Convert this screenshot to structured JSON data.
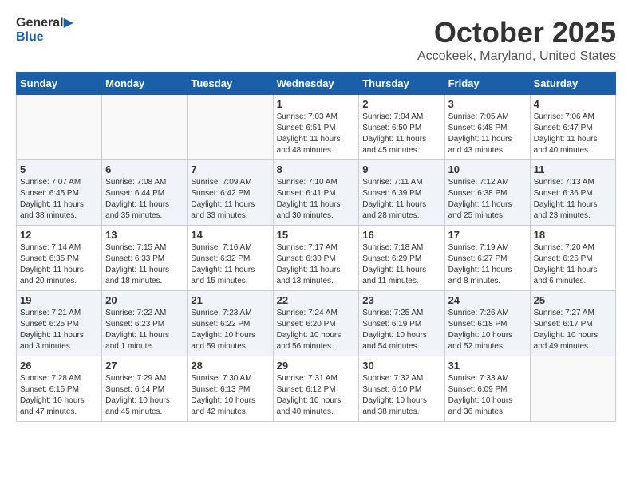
{
  "header": {
    "logo_general": "General",
    "logo_blue": "Blue",
    "month_title": "October 2025",
    "location": "Accokeek, Maryland, United States"
  },
  "weekdays": [
    "Sunday",
    "Monday",
    "Tuesday",
    "Wednesday",
    "Thursday",
    "Friday",
    "Saturday"
  ],
  "weeks": [
    [
      {
        "num": "",
        "info": ""
      },
      {
        "num": "",
        "info": ""
      },
      {
        "num": "",
        "info": ""
      },
      {
        "num": "1",
        "info": "Sunrise: 7:03 AM\nSunset: 6:51 PM\nDaylight: 11 hours\nand 48 minutes."
      },
      {
        "num": "2",
        "info": "Sunrise: 7:04 AM\nSunset: 6:50 PM\nDaylight: 11 hours\nand 45 minutes."
      },
      {
        "num": "3",
        "info": "Sunrise: 7:05 AM\nSunset: 6:48 PM\nDaylight: 11 hours\nand 43 minutes."
      },
      {
        "num": "4",
        "info": "Sunrise: 7:06 AM\nSunset: 6:47 PM\nDaylight: 11 hours\nand 40 minutes."
      }
    ],
    [
      {
        "num": "5",
        "info": "Sunrise: 7:07 AM\nSunset: 6:45 PM\nDaylight: 11 hours\nand 38 minutes."
      },
      {
        "num": "6",
        "info": "Sunrise: 7:08 AM\nSunset: 6:44 PM\nDaylight: 11 hours\nand 35 minutes."
      },
      {
        "num": "7",
        "info": "Sunrise: 7:09 AM\nSunset: 6:42 PM\nDaylight: 11 hours\nand 33 minutes."
      },
      {
        "num": "8",
        "info": "Sunrise: 7:10 AM\nSunset: 6:41 PM\nDaylight: 11 hours\nand 30 minutes."
      },
      {
        "num": "9",
        "info": "Sunrise: 7:11 AM\nSunset: 6:39 PM\nDaylight: 11 hours\nand 28 minutes."
      },
      {
        "num": "10",
        "info": "Sunrise: 7:12 AM\nSunset: 6:38 PM\nDaylight: 11 hours\nand 25 minutes."
      },
      {
        "num": "11",
        "info": "Sunrise: 7:13 AM\nSunset: 6:36 PM\nDaylight: 11 hours\nand 23 minutes."
      }
    ],
    [
      {
        "num": "12",
        "info": "Sunrise: 7:14 AM\nSunset: 6:35 PM\nDaylight: 11 hours\nand 20 minutes."
      },
      {
        "num": "13",
        "info": "Sunrise: 7:15 AM\nSunset: 6:33 PM\nDaylight: 11 hours\nand 18 minutes."
      },
      {
        "num": "14",
        "info": "Sunrise: 7:16 AM\nSunset: 6:32 PM\nDaylight: 11 hours\nand 15 minutes."
      },
      {
        "num": "15",
        "info": "Sunrise: 7:17 AM\nSunset: 6:30 PM\nDaylight: 11 hours\nand 13 minutes."
      },
      {
        "num": "16",
        "info": "Sunrise: 7:18 AM\nSunset: 6:29 PM\nDaylight: 11 hours\nand 11 minutes."
      },
      {
        "num": "17",
        "info": "Sunrise: 7:19 AM\nSunset: 6:27 PM\nDaylight: 11 hours\nand 8 minutes."
      },
      {
        "num": "18",
        "info": "Sunrise: 7:20 AM\nSunset: 6:26 PM\nDaylight: 11 hours\nand 6 minutes."
      }
    ],
    [
      {
        "num": "19",
        "info": "Sunrise: 7:21 AM\nSunset: 6:25 PM\nDaylight: 11 hours\nand 3 minutes."
      },
      {
        "num": "20",
        "info": "Sunrise: 7:22 AM\nSunset: 6:23 PM\nDaylight: 11 hours\nand 1 minute."
      },
      {
        "num": "21",
        "info": "Sunrise: 7:23 AM\nSunset: 6:22 PM\nDaylight: 10 hours\nand 59 minutes."
      },
      {
        "num": "22",
        "info": "Sunrise: 7:24 AM\nSunset: 6:20 PM\nDaylight: 10 hours\nand 56 minutes."
      },
      {
        "num": "23",
        "info": "Sunrise: 7:25 AM\nSunset: 6:19 PM\nDaylight: 10 hours\nand 54 minutes."
      },
      {
        "num": "24",
        "info": "Sunrise: 7:26 AM\nSunset: 6:18 PM\nDaylight: 10 hours\nand 52 minutes."
      },
      {
        "num": "25",
        "info": "Sunrise: 7:27 AM\nSunset: 6:17 PM\nDaylight: 10 hours\nand 49 minutes."
      }
    ],
    [
      {
        "num": "26",
        "info": "Sunrise: 7:28 AM\nSunset: 6:15 PM\nDaylight: 10 hours\nand 47 minutes."
      },
      {
        "num": "27",
        "info": "Sunrise: 7:29 AM\nSunset: 6:14 PM\nDaylight: 10 hours\nand 45 minutes."
      },
      {
        "num": "28",
        "info": "Sunrise: 7:30 AM\nSunset: 6:13 PM\nDaylight: 10 hours\nand 42 minutes."
      },
      {
        "num": "29",
        "info": "Sunrise: 7:31 AM\nSunset: 6:12 PM\nDaylight: 10 hours\nand 40 minutes."
      },
      {
        "num": "30",
        "info": "Sunrise: 7:32 AM\nSunset: 6:10 PM\nDaylight: 10 hours\nand 38 minutes."
      },
      {
        "num": "31",
        "info": "Sunrise: 7:33 AM\nSunset: 6:09 PM\nDaylight: 10 hours\nand 36 minutes."
      },
      {
        "num": "",
        "info": ""
      }
    ]
  ]
}
